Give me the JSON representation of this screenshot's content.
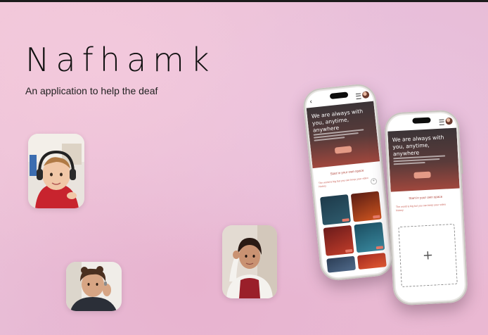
{
  "brand": {
    "name": "Nafhamk",
    "tagline": "An application to help the deaf"
  },
  "photos": [
    {
      "subject": "child-with-headphones"
    },
    {
      "subject": "boy-with-hearing-aid"
    },
    {
      "subject": "girl-pointing-to-ear"
    }
  ],
  "app": {
    "hero_title": "We are always with you, anytime, anywhere",
    "section_title": "Start in your own space",
    "section_sub": "The world is big but you can keep your video history",
    "upload_plus": "+",
    "back_glyph": "‹"
  },
  "colors": {
    "accent": "#b0453b",
    "button": "#e49a86"
  }
}
